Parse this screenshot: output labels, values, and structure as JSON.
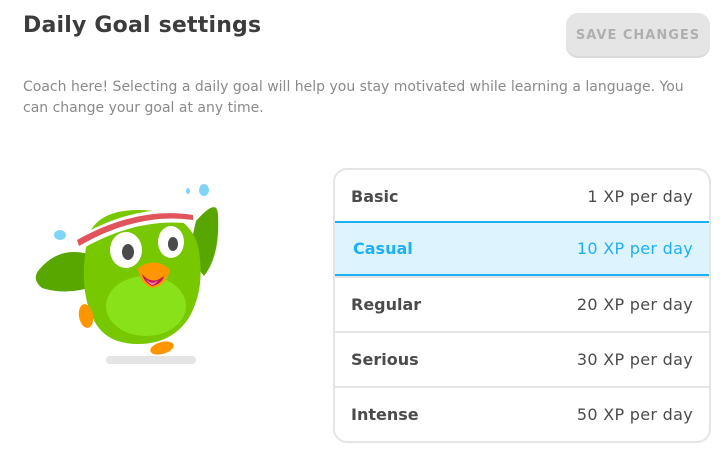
{
  "header": {
    "title": "Daily Goal settings",
    "save_label": "SAVE CHANGES"
  },
  "description": "Coach here! Selecting a daily goal will help you stay motivated while learning a language. You can change your goal at any time.",
  "goals": [
    {
      "name": "Basic",
      "xp": "1 XP per day",
      "selected": false
    },
    {
      "name": "Casual",
      "xp": "10 XP per day",
      "selected": true
    },
    {
      "name": "Regular",
      "xp": "20 XP per day",
      "selected": false
    },
    {
      "name": "Serious",
      "xp": "30 XP per day",
      "selected": false
    },
    {
      "name": "Intense",
      "xp": "50 XP per day",
      "selected": false
    }
  ],
  "colors": {
    "accent": "#1cb0f6",
    "selected_bg": "#ddf4ff",
    "owl_green": "#78c800",
    "headband_red": "#e2545c",
    "disabled_button": "#e5e5e5"
  },
  "illustration": "coach-owl-icon"
}
